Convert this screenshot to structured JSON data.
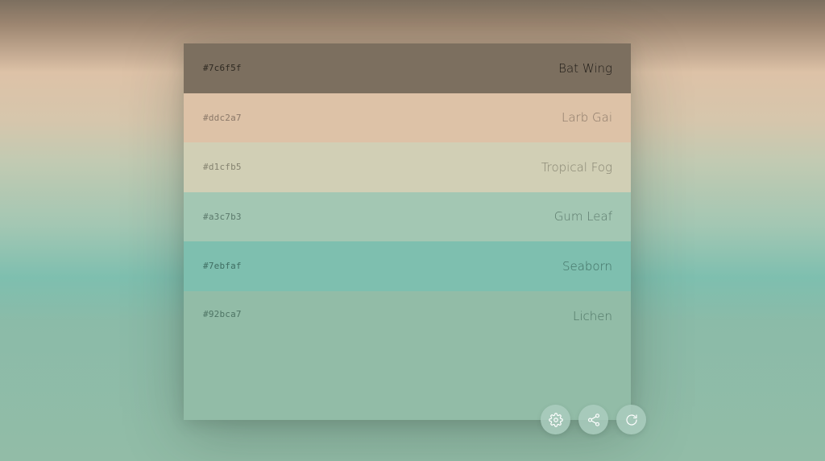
{
  "palette": {
    "colors": [
      {
        "hex": "#7c6f5f",
        "name": "Bat Wing",
        "bg": "#7c6f5f",
        "hex_color": "#2f2a22",
        "name_color": "#1f1b16"
      },
      {
        "hex": "#ddc2a7",
        "name": "Larb Gai",
        "bg": "#ddc2a7",
        "hex_color": "#8a7868",
        "name_color": "#8a7868"
      },
      {
        "hex": "#d1cfb5",
        "name": "Tropical Fog",
        "bg": "#d1cfb5",
        "hex_color": "#858370",
        "name_color": "#858370"
      },
      {
        "hex": "#a3c7b3",
        "name": "Gum Leaf",
        "bg": "#a3c7b3",
        "hex_color": "#5c7a6c",
        "name_color": "#5c7a6c"
      },
      {
        "hex": "#7ebfaf",
        "name": "Seaborn",
        "bg": "#7ebfaf",
        "hex_color": "#3f6d62",
        "name_color": "#3f6d62"
      },
      {
        "hex": "#92bca7",
        "name": "Lichen",
        "bg": "#92bca7",
        "hex_color": "#4e7464",
        "name_color": "#4e7464"
      }
    ]
  },
  "controls": [
    {
      "icon": "gear-icon"
    },
    {
      "icon": "share-icon"
    },
    {
      "icon": "refresh-icon"
    }
  ]
}
